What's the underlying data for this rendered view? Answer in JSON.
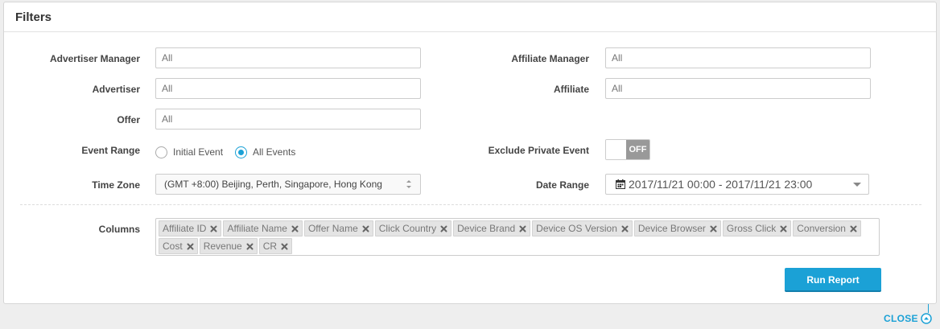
{
  "title": "Filters",
  "fields": {
    "advertiser_manager": {
      "label": "Advertiser Manager",
      "placeholder": "All"
    },
    "advertiser": {
      "label": "Advertiser",
      "placeholder": "All"
    },
    "offer": {
      "label": "Offer",
      "placeholder": "All"
    },
    "affiliate_manager": {
      "label": "Affiliate Manager",
      "placeholder": "All"
    },
    "affiliate": {
      "label": "Affiliate",
      "placeholder": "All"
    }
  },
  "event_range": {
    "label": "Event Range",
    "options": [
      "Initial Event",
      "All Events"
    ],
    "selected": "All Events"
  },
  "exclude_private": {
    "label": "Exclude Private Event",
    "state": "OFF"
  },
  "time_zone": {
    "label": "Time Zone",
    "value": "(GMT +8:00) Beijing, Perth, Singapore, Hong Kong"
  },
  "date_range": {
    "label": "Date Range",
    "value": "2017/11/21 00:00 - 2017/11/21 23:00"
  },
  "columns": {
    "label": "Columns",
    "tags": [
      "Affiliate ID",
      "Affiliate Name",
      "Offer Name",
      "Click Country",
      "Device Brand",
      "Device OS Version",
      "Device Browser",
      "Gross Click",
      "Conversion",
      "Cost",
      "Revenue",
      "CR"
    ]
  },
  "run_report": "Run Report",
  "close": "CLOSE",
  "colors": {
    "accent": "#1ba1d6",
    "toggle_off": "#999999"
  }
}
